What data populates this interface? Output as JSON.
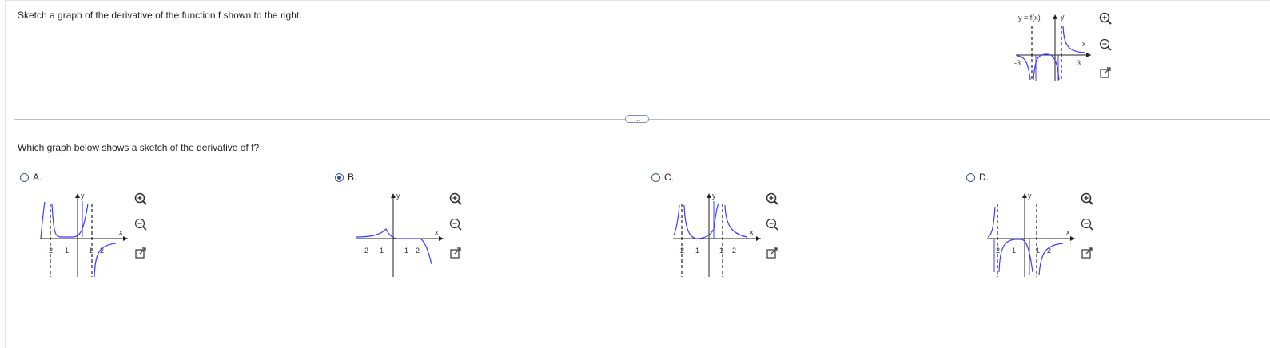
{
  "question": "Sketch a graph of the derivative of the function f shown to the right.",
  "prompt": "Which graph below shows a sketch of the derivative of f?",
  "more_label": "…",
  "selected_option": "B",
  "colors": {
    "curve": "#3c3cff",
    "axis": "#222222",
    "radio_fill": "#2f4f9f"
  },
  "icons": [
    "zoom-in-icon",
    "zoom-out-icon",
    "popout-icon"
  ],
  "top_graph": {
    "title": "y = f(x)",
    "y_label": "y",
    "x_label": "x",
    "tick_left": "-3",
    "tick_right": "3"
  },
  "options": [
    {
      "letter": "A.",
      "y_label": "y",
      "x_label": "x",
      "ticks": [
        "-2",
        "-1",
        "1",
        "2"
      ]
    },
    {
      "letter": "B.",
      "y_label": "y",
      "x_label": "x",
      "ticks": [
        "-2",
        "-1",
        "1",
        "2"
      ]
    },
    {
      "letter": "C.",
      "y_label": "y",
      "x_label": "x",
      "ticks": [
        "-2",
        "-1",
        "1",
        "2"
      ]
    },
    {
      "letter": "D.",
      "y_label": "y",
      "x_label": "x",
      "ticks": [
        "-2",
        "-1",
        "1",
        "2"
      ]
    }
  ]
}
